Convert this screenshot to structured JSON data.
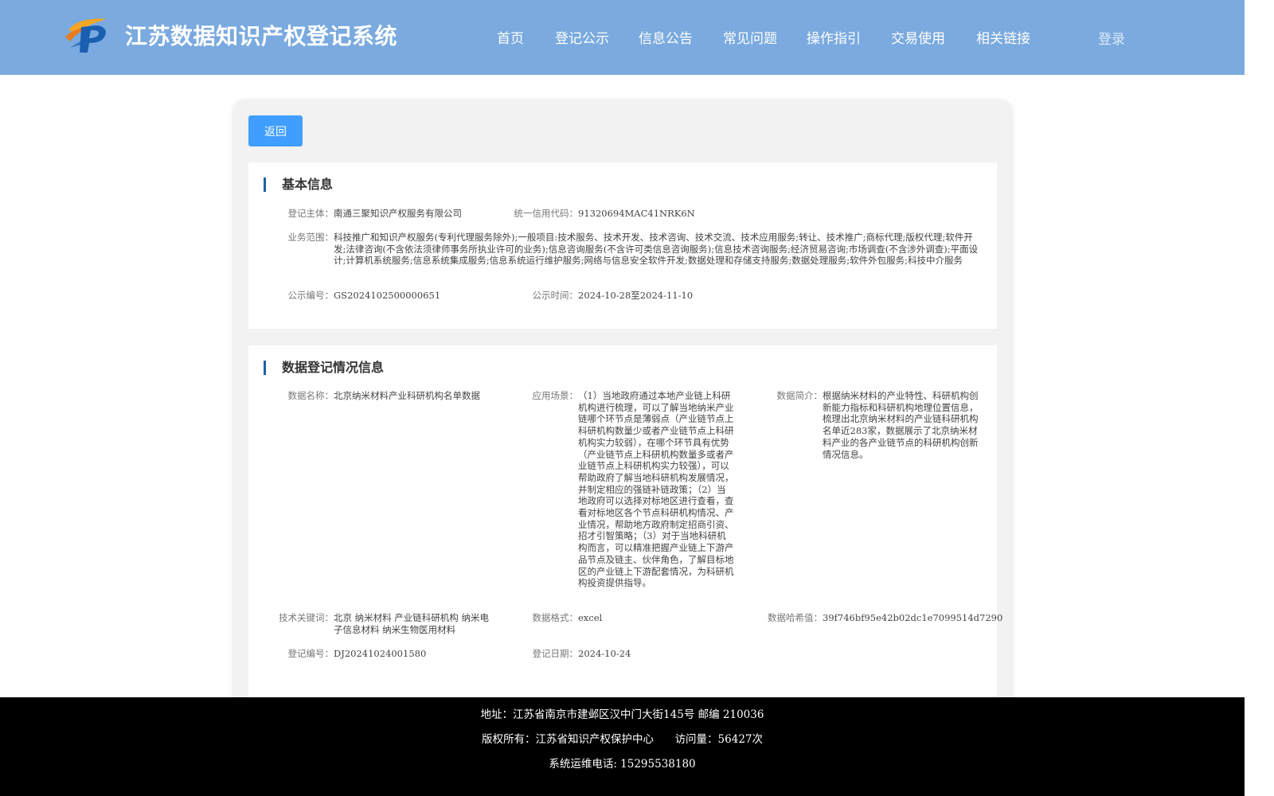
{
  "header": {
    "site_title": "江苏数据知识产权登记系统",
    "nav": [
      "首页",
      "登记公示",
      "信息公告",
      "常见问题",
      "操作指引",
      "交易使用",
      "相关链接"
    ],
    "login": "登录",
    "colors": {
      "header_bg": "#7aaadf",
      "button": "#409eff",
      "title_bar": "#1f5fa8"
    }
  },
  "actions": {
    "back": "返回"
  },
  "basic_info": {
    "title": "基本信息",
    "subject_label": "登记主体：",
    "subject": "南通三聚知识产权服务有限公司",
    "credit_code_label": "统一信用代码：",
    "credit_code": "91320694MAC41NRK6N",
    "scope_label": "业务范围：",
    "scope": "科技推广和知识产权服务(专利代理服务除外);一般项目:技术服务、技术开发、技术咨询、技术交流、技术应用服务;转让、技术推广;商标代理;版权代理;软件开发;法律咨询(不含依法须律师事务所执业许可的业务);信息咨询服务(不含许可类信息咨询服务);信息技术咨询服务;经济贸易咨询;市场调查(不含涉外调查);平面设计;计算机系统服务;信息系统集成服务;信息系统运行维护服务;网络与信息安全软件开发;数据处理和存储支持服务;数据处理服务;软件外包服务;科技中介服务",
    "notice_no_label": "公示编号：",
    "notice_no": "GS2024102500000651",
    "notice_time_label": "公示时间：",
    "notice_time": "2024-10-28至2024-11-10"
  },
  "data_info": {
    "title": "数据登记情况信息",
    "name_label": "数据名称：",
    "name": "北京纳米材料产业科研机构名单数据",
    "scene_label": "应用场景：",
    "scene": "（1）当地政府通过本地产业链上科研机构进行梳理，可以了解当地纳米产业链哪个环节点是薄弱点（产业链节点上科研机构数量少或者产业链节点上科研机构实力较弱），在哪个环节具有优势（产业链节点上科研机构数量多或者产业链节点上科研机构实力较强），可以帮助政府了解当地科研机构发展情况，并制定相应的强链补链政策；（2）当地政府可以选择对标地区进行查看，查看对标地区各个节点科研机构情况、产业情况，帮助地方政府制定招商引资、招才引智策略；（3）对于当地科研机构而言，可以精准把握产业链上下游产品节点及链主、伙伴角色，了解目标地区的产业链上下游配套情况，为科研机构投资提供指导。",
    "intro_label": "数据简介：",
    "intro": "根据纳米材料的产业特性、科研机构创新能力指标和科研机构地理位置信息，梳理出北京纳米材料的产业链科研机构名单近283家，数据展示了北京纳米材料产业的各产业链节点的科研机构创新情况信息。",
    "keywords_label": "技术关键词：",
    "keywords": "北京 纳米材料 产业链科研机构 纳米电子信息材料 纳米生物医用材料",
    "format_label": "数据格式：",
    "format": "excel",
    "hash_label": "数据哈希值：",
    "hash": "39f746bf95e42b02dc1e7099514d7290",
    "reg_no_label": "登记编号：",
    "reg_no": "DJ20241024001580",
    "reg_date_label": "登记日期：",
    "reg_date": "2024-10-24"
  },
  "footer": {
    "address": "地址：江苏省南京市建邺区汉中门大街145号 邮编 210036",
    "copyright": "版权所有：江苏省知识产权保护中心",
    "visits": "访问量：56427次",
    "hotline": "系统运维电话: 15295538180"
  }
}
